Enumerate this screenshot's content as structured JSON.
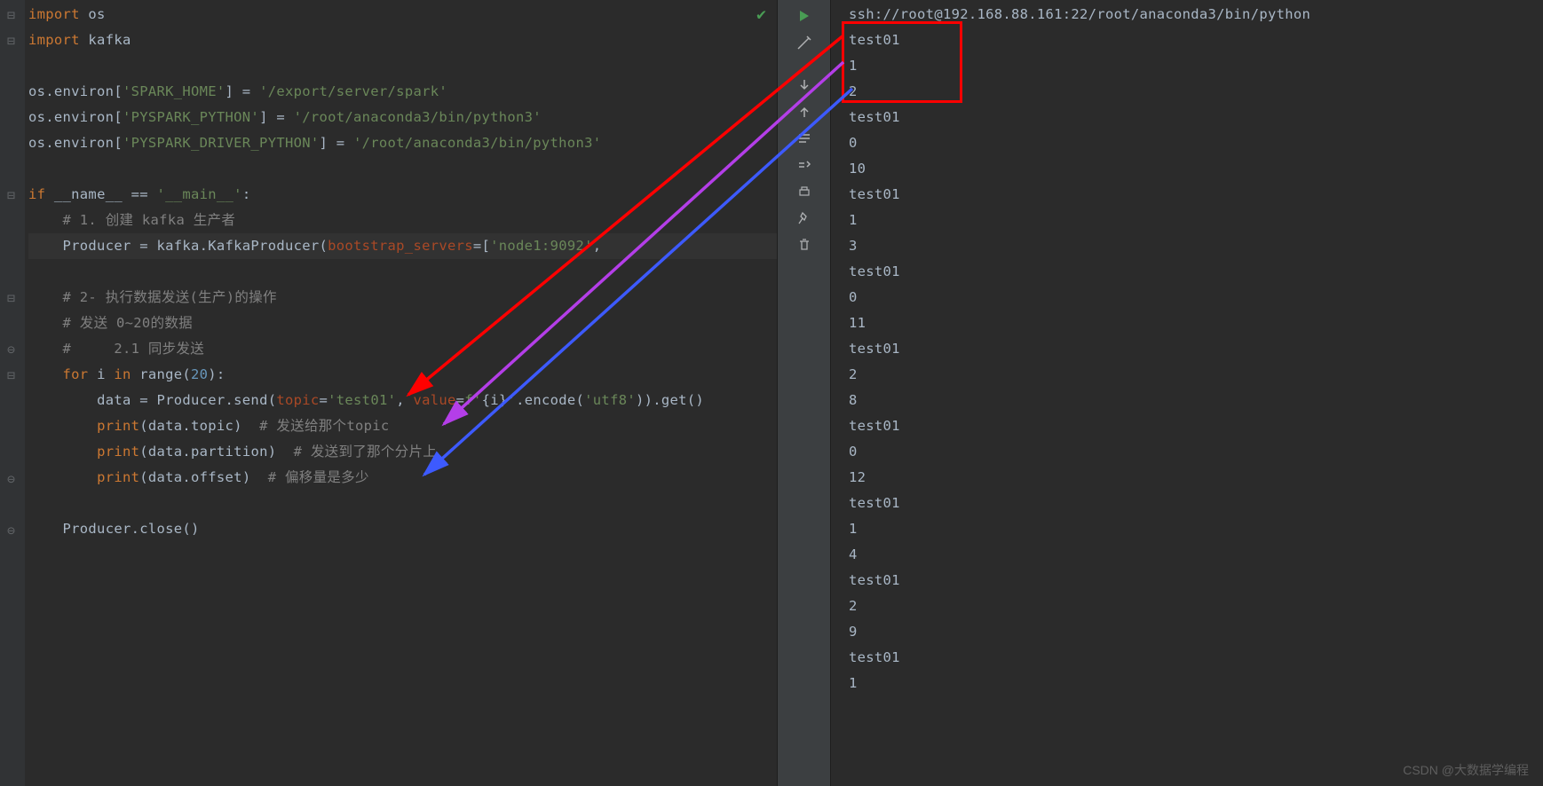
{
  "code": {
    "l1": {
      "kw1": "import",
      "id1": " os"
    },
    "l2": {
      "kw1": "import",
      "id1": " kafka"
    },
    "l3": "",
    "l4": {
      "p1": "os.environ[",
      "s1": "'SPARK_HOME'",
      "p2": "] = ",
      "s2": "'/export/server/spark'"
    },
    "l5": {
      "p1": "os.environ[",
      "s1": "'PYSPARK_PYTHON'",
      "p2": "] = ",
      "s2": "'/root/anaconda3/bin/python3'"
    },
    "l6": {
      "p1": "os.environ[",
      "s1": "'PYSPARK_DRIVER_PYTHON'",
      "p2": "] = ",
      "s2": "'/root/anaconda3/bin/python3'"
    },
    "l7": "",
    "l8": {
      "kw1": "if ",
      "id1": "__name__ == ",
      "s1": "'__main__'",
      "p1": ":"
    },
    "l9": {
      "indent": "    ",
      "c1": "# 1. 创建 kafka 生产者"
    },
    "l10": {
      "indent": "    ",
      "p1": "Producer = kafka.KafkaProducer(",
      "param1": "bootstrap_servers",
      "p2": "=[",
      "s1": "'node1:9092'",
      "p3": ","
    },
    "l11": "",
    "l12": {
      "indent": "    ",
      "c1": "# 2- 执行数据发送(生产)的操作"
    },
    "l13": {
      "indent": "    ",
      "c1": "# 发送 0~20的数据"
    },
    "l14": {
      "indent": "    ",
      "c1": "#     2.1 同步发送"
    },
    "l15": {
      "indent": "    ",
      "kw1": "for ",
      "id1": "i ",
      "kw2": "in ",
      "id2": "range(",
      "n1": "20",
      "p1": "):"
    },
    "l16": {
      "indent": "        ",
      "p1": "data = Producer.send(",
      "param1": "topic",
      "p2": "=",
      "s1": "'test01'",
      "p3": ", ",
      "param2": "value",
      "p4": "=",
      "s2": "f'",
      "p5": "{i}",
      "s3": "'",
      "p6": ".encode(",
      "s4": "'utf8'",
      "p7": ")).get()"
    },
    "l17": {
      "indent": "        ",
      "kw1": "print",
      "p1": "(data.topic)  ",
      "c1": "# 发送给那个topic"
    },
    "l18": {
      "indent": "        ",
      "kw1": "print",
      "p1": "(data.partition)  ",
      "c1": "# 发送到了那个分片上"
    },
    "l19": {
      "indent": "        ",
      "kw1": "print",
      "p1": "(data.offset)  ",
      "c1": "# 偏移量是多少"
    },
    "l20": "",
    "l21": {
      "indent": "    ",
      "p1": "Producer.close()"
    }
  },
  "output": {
    "header": "ssh://root@192.168.88.161:22/root/anaconda3/bin/python",
    "lines": [
      "test01",
      "1",
      "2",
      "test01",
      "0",
      "10",
      "test01",
      "1",
      "3",
      "test01",
      "0",
      "11",
      "test01",
      "2",
      "8",
      "test01",
      "0",
      "12",
      "test01",
      "1",
      "4",
      "test01",
      "2",
      "9",
      "test01",
      "1"
    ]
  },
  "watermark": "CSDN @大数据学编程"
}
